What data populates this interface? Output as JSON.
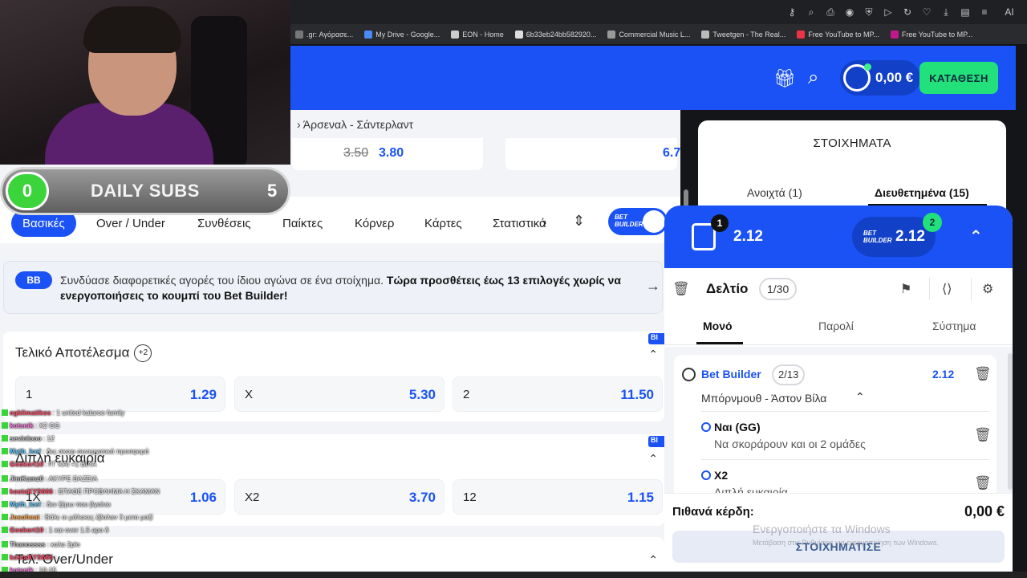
{
  "browser": {
    "bookmarks": [
      {
        "label": ".gr: Αγόρασε..."
      },
      {
        "label": "My Drive - Google..."
      },
      {
        "label": "EON - Home"
      },
      {
        "label": "6b33eb24bb582920..."
      },
      {
        "label": "Commercial Music L..."
      },
      {
        "label": "Tweetgen - The Real..."
      },
      {
        "label": "Free YouTube to MP..."
      },
      {
        "label": "Free YouTube to MP..."
      }
    ],
    "ai_label": "AI"
  },
  "header": {
    "balance": "0,00 €",
    "deposit_label": "ΚΑΤΑΘΕΣΗ"
  },
  "match": {
    "breadcrumb": "Άρσεναλ - Σάντερλαντ",
    "old_odd": "3.50",
    "new_odd": "3.80",
    "second_odd": "6.7"
  },
  "market_tabs": {
    "items": [
      "Βασικές",
      "Over / Under",
      "Συνθέσεις",
      "Παίκτες",
      "Κόρνερ",
      "Κάρτες",
      "Στατιστικά"
    ],
    "bb_toggle_label": "BET BUILDER"
  },
  "bb_banner": {
    "logo": "BB",
    "text": "Συνδύασε διαφορετικές αγορές του ίδιου αγώνα σε ένα στοίχημα.",
    "bold": "Τώρα προσθέτεις έως 13 επιλογές χωρίς να ενεργοποιήσεις το κουμπί του Bet Builder!"
  },
  "markets": [
    {
      "title": "Τελικό Αποτέλεσμα",
      "badge": "+2",
      "outcomes": [
        {
          "label": "1",
          "odd": "1.29"
        },
        {
          "label": "X",
          "odd": "5.30"
        },
        {
          "label": "2",
          "odd": "11.50"
        }
      ]
    },
    {
      "title": "Διπλή ευκαιρία",
      "outcomes": [
        {
          "label": "1X",
          "odd": "1.06"
        },
        {
          "label": "X2",
          "odd": "3.70"
        },
        {
          "label": "12",
          "odd": "1.15"
        }
      ]
    },
    {
      "title": "Τελ. Over/Under"
    }
  ],
  "bets_panel": {
    "title": "ΣΤΟΙΧΗΜΑΤΑ",
    "open": "Ανοιχτά (1)",
    "settled": "Διευθετημένα (15)"
  },
  "betslip": {
    "count": "1",
    "odds": "2.12",
    "bb_logo": "BET BUILDER",
    "bb_odds": "2.12",
    "bb_count": "2",
    "label": "Δελτίο",
    "of": "1/30",
    "types": [
      "Μονό",
      "Παρολί",
      "Σύστημα"
    ],
    "selection": {
      "title": "Bet Builder",
      "count": "2/13",
      "odds": "2.12",
      "match": "Μπόρνμουθ - Άστον Βίλα",
      "legs": [
        {
          "name": "Ναι (GG)",
          "desc": "Να σκοράρουν και οι 2 ομάδες"
        },
        {
          "name": "X2",
          "desc": "Διπλή ευκαιρία"
        }
      ]
    },
    "winnings_label": "Πιθανά κέρδη:",
    "winnings": "0,00 €",
    "place_label": "ΣΤΟΙΧΗΜΑΤΙΣΕ",
    "watermark1": "Ενεργοποιήστε τα Windows",
    "watermark2": "Μετάβαση στις Ρυθμίσεις για ενεργοποίηση των Windows."
  },
  "overlay": {
    "subs_current": "0",
    "subs_label": "DAILY SUBS",
    "subs_goal": "5"
  },
  "chat": [
    {
      "user": "egklimatikos",
      "msg": ": 1 united kalaroo family",
      "color": "#ff4d6d"
    },
    {
      "user": "kotsnik",
      "msg": ": X2 GG",
      "color": "#ff7ae0"
    },
    {
      "user": "sevinlooo",
      "msg": ": 12",
      "color": "#bfbfbf"
    },
    {
      "user": "Myth_Ice!",
      "msg": ": δες σκοιρ συνεργατικά προσφορά",
      "color": "#5fc8ff"
    },
    {
      "user": "Geokort10",
      "msg": ": ΓΓ ΚΑΙ +1 ΒΙΛΑ",
      "color": "#ff4d6d"
    },
    {
      "user": "JimKamz0",
      "msg": ": ΑΚΥΡΕ ΒΑΖΕΙΑ",
      "color": "#bfbfbf"
    },
    {
      "user": "kostaKYS666",
      "msg": ": ΕΠΑΘΕ ΠΡΟΒΛΗΜΑ Η ΣΚΑΜΑΝ",
      "color": "#ff4d6d"
    },
    {
      "user": "Myth_Ice!",
      "msg": ": δεν ξέρω που βγαίνει",
      "color": "#5fc8ff"
    },
    {
      "user": "Josoheat",
      "msg": ": Βάλε οι μάλακες έβαλαν 3 μετα μαζί",
      "color": "#ffa24d"
    },
    {
      "user": "Geokort10",
      "msg": ": 1 και over 1.5 apo δ",
      "color": "#ff4d6d"
    },
    {
      "user": "Thanossss",
      "msg": ": καλα 2plo",
      "color": "#bfbfbf"
    },
    {
      "user": "kostaKYS666",
      "msg": ": ...",
      "color": "#ff4d6d"
    },
    {
      "user": "kotsnik",
      "msg": ": 10-15",
      "color": "#ff7ae0"
    }
  ]
}
